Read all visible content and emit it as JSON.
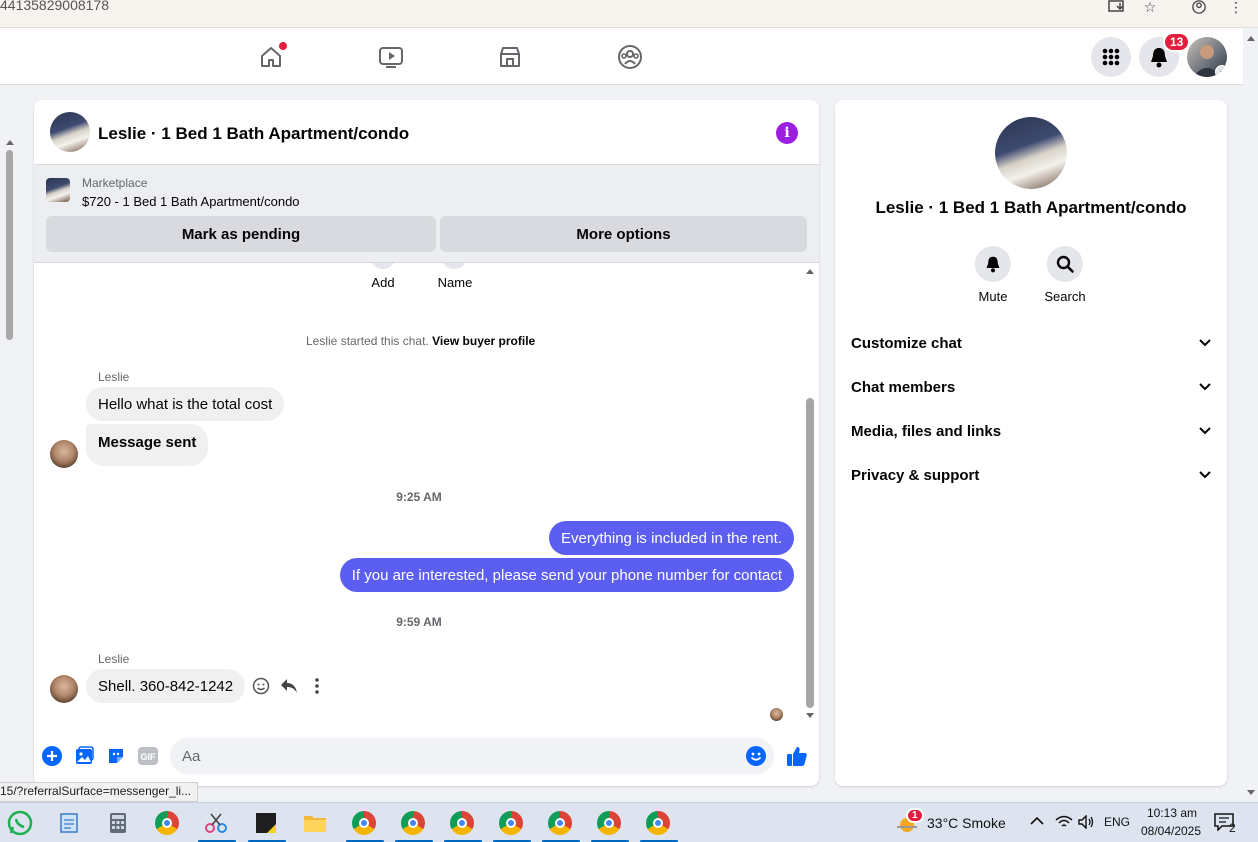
{
  "browser": {
    "url_fragment": "44135829008178",
    "status_url": "15/?referralSurface=messenger_li..."
  },
  "navbar": {
    "notifications_count": "13"
  },
  "chat": {
    "title": "Leslie · 1 Bed 1 Bath Apartment/condo",
    "marketplace_label": "Marketplace",
    "listing": "$720 - 1 Bed 1 Bath Apartment/condo",
    "mark_pending_label": "Mark as pending",
    "more_options_label": "More options",
    "add_label": "Add",
    "name_label": "Name",
    "system_text": "Leslie started this chat.",
    "view_profile_label": "View buyer profile",
    "messages": [
      {
        "sender": "Leslie",
        "text": "Hello what is the total cost"
      },
      {
        "text": "Message sent"
      },
      {
        "timestamp": "9:25 AM"
      },
      {
        "text": "Everything is included in the rent."
      },
      {
        "text": "If you are interested, please send your phone number for contact"
      },
      {
        "timestamp": "9:59 AM"
      },
      {
        "sender": "Leslie",
        "text": "Shell. 360-842-1242"
      }
    ],
    "composer_placeholder": "Aa"
  },
  "side": {
    "title": "Leslie · 1 Bed 1 Bath Apartment/condo",
    "mute_label": "Mute",
    "search_label": "Search",
    "sections": [
      "Customize chat",
      "Chat members",
      "Media, files and links",
      "Privacy & support"
    ]
  },
  "taskbar": {
    "weather_badge": "1",
    "weather": "33°C  Smoke",
    "lang": "ENG",
    "time": "10:13 am",
    "date": "08/04/2025",
    "notif_count": "2"
  },
  "colors": {
    "outgoing_bubble": "#5b5ef0",
    "accent_purple": "#9b1fe0",
    "fb_blue": "#0866ff",
    "badge_red": "#e41e3f"
  }
}
